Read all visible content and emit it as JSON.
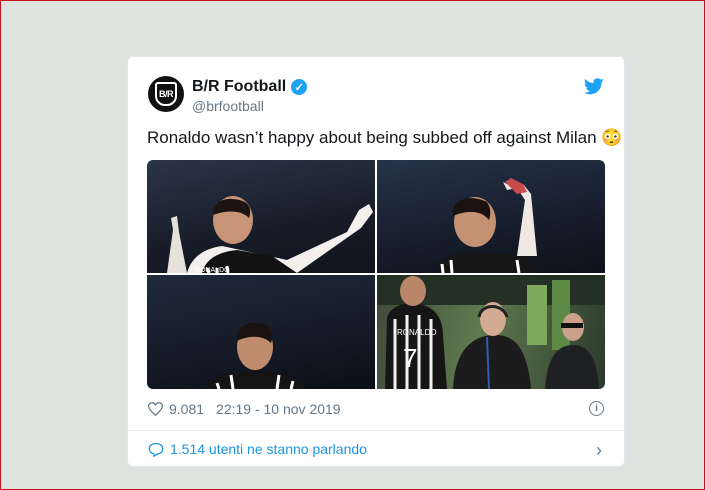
{
  "tweet": {
    "author_name": "B/R Football",
    "handle": "@brfootball",
    "avatar_text": "B/R",
    "text": "Ronaldo wasn’t happy about being subbed off against Milan 😳",
    "likes": "9.081",
    "timestamp": "22:19 - 10 nov 2019",
    "conversation": "1.514 utenti ne stanno parlando",
    "photos": [
      "ronaldo-pointing-left",
      "ronaldo-pointing-up",
      "ronaldo-walking",
      "ronaldo-touchline"
    ],
    "jersey_text": "RONALDO",
    "jersey_number": "7"
  },
  "colors": {
    "accent": "#1da1f2",
    "link": "#1b95e0",
    "text": "#14171a",
    "muted": "#657786",
    "frame": "#c8141e"
  },
  "icons": [
    "verified-icon",
    "twitter-bird-icon",
    "heart-icon",
    "info-icon",
    "comment-icon",
    "chevron-right-icon"
  ]
}
